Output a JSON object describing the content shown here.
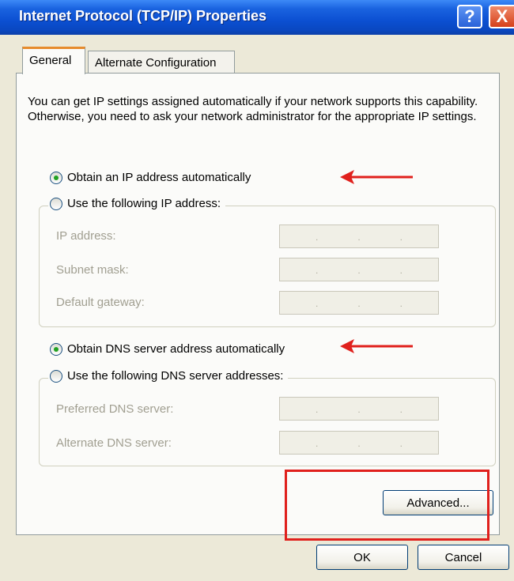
{
  "window": {
    "title": "Internet Protocol (TCP/IP) Properties",
    "help_label": "?",
    "close_label": "X"
  },
  "tabs": [
    {
      "label": "General",
      "active": true
    },
    {
      "label": "Alternate Configuration",
      "active": false
    }
  ],
  "general": {
    "intro_text": "You can get IP settings assigned automatically if your network supports this capability. Otherwise, you need to ask your network administrator for the appropriate IP settings.",
    "ip_auto_label": "Obtain an IP address automatically",
    "ip_manual_label": "Use the following IP address:",
    "ip_fields": [
      {
        "label": "IP address:"
      },
      {
        "label": "Subnet mask:"
      },
      {
        "label": "Default gateway:"
      }
    ],
    "dns_auto_label": "Obtain DNS server address automatically",
    "dns_manual_label": "Use the following DNS server addresses:",
    "dns_fields": [
      {
        "label": "Preferred DNS server:"
      },
      {
        "label": "Alternate DNS server:"
      }
    ],
    "ip_mode": "automatic",
    "dns_mode": "automatic"
  },
  "buttons": {
    "advanced": "Advanced...",
    "ok": "OK",
    "cancel": "Cancel"
  },
  "annotation": {
    "arrow_color": "#e0201c",
    "box_color": "#e0201c"
  }
}
